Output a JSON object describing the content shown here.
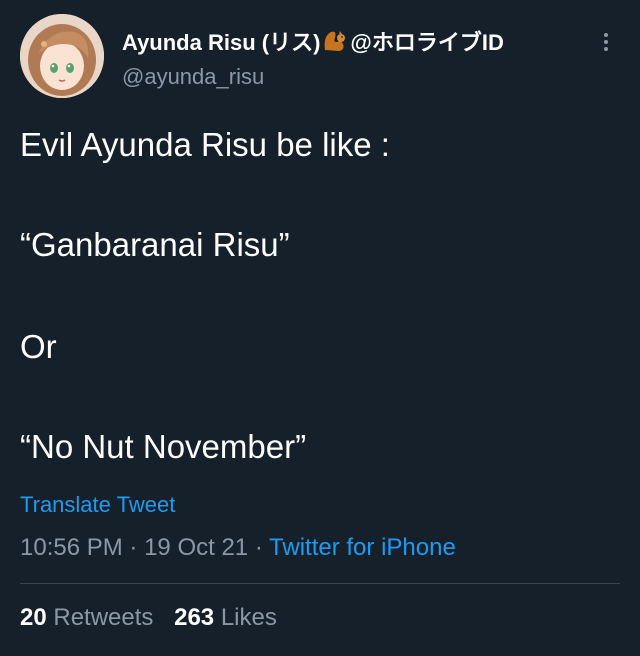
{
  "tweet": {
    "display_name_prefix": "Ayunda Risu (リス)",
    "display_name_suffix": "@ホロライブID",
    "emoji_icon": "squirrel-icon",
    "handle": "@ayunda_risu",
    "text_lines": [
      "Evil Ayunda Risu be like :",
      "“Ganbaranai Risu”",
      "Or",
      "“No Nut November”"
    ],
    "translate_label": "Translate Tweet",
    "time": "10:56 PM",
    "separator": "·",
    "date": "19 Oct 21",
    "source": "Twitter for iPhone",
    "retweets_count": "20",
    "retweets_label": "Retweets",
    "likes_count": "263",
    "likes_label": "Likes"
  },
  "colors": {
    "background": "#15202b",
    "text": "#ffffff",
    "secondary": "#8b98a5",
    "link": "#1d9bf0",
    "divider": "#38444d"
  }
}
